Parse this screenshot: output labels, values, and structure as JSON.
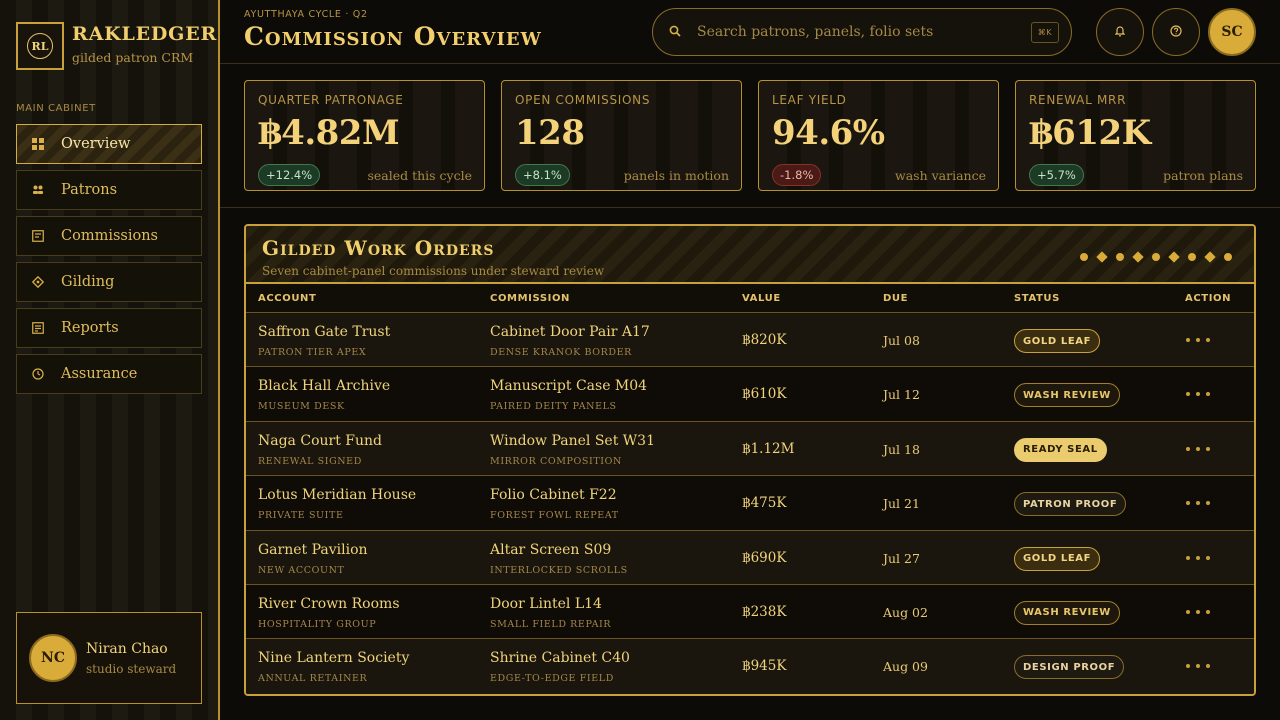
{
  "brand": {
    "initials": "RL",
    "name": "RAKLEDGER",
    "tagline": "gilded patron CRM"
  },
  "sidebar": {
    "section_label": "MAIN CABINET",
    "items": [
      {
        "label": "Overview",
        "icon": "grid-icon",
        "active": true
      },
      {
        "label": "Patrons",
        "icon": "people-icon",
        "active": false
      },
      {
        "label": "Commissions",
        "icon": "ledger-icon",
        "active": false
      },
      {
        "label": "Gilding",
        "icon": "diamond-icon",
        "active": false
      },
      {
        "label": "Reports",
        "icon": "report-icon",
        "active": false
      },
      {
        "label": "Assurance",
        "icon": "clock-icon",
        "active": false
      }
    ],
    "user": {
      "initials": "NC",
      "name": "Niran Chao",
      "role": "studio steward"
    }
  },
  "header": {
    "eyebrow": "AYUTTHAYA CYCLE · Q2",
    "title": "Commission Overview",
    "search_placeholder": "Search patrons, panels, folio sets",
    "search_shortcut": "⌘K",
    "user_initials": "SC"
  },
  "kpis": [
    {
      "label": "QUARTER PATRONAGE",
      "value": "฿4.82M",
      "delta": "+12.4%",
      "trend": "up",
      "note": "sealed this cycle"
    },
    {
      "label": "OPEN COMMISSIONS",
      "value": "128",
      "delta": "+8.1%",
      "trend": "up",
      "note": "panels in motion"
    },
    {
      "label": "LEAF YIELD",
      "value": "94.6%",
      "delta": "-1.8%",
      "trend": "down",
      "note": "wash variance"
    },
    {
      "label": "RENEWAL MRR",
      "value": "฿612K",
      "delta": "+5.7%",
      "trend": "up",
      "note": "patron plans"
    }
  ],
  "table": {
    "title": "Gilded Work Orders",
    "subtitle": "Seven cabinet-panel commissions under steward review",
    "columns": [
      "ACCOUNT",
      "COMMISSION",
      "VALUE",
      "DUE",
      "STATUS",
      "ACTION"
    ],
    "rows": [
      {
        "account": "Saffron Gate Trust",
        "account_sub": "PATRON TIER APEX",
        "commission": "Cabinet Door Pair A17",
        "commission_sub": "DENSE KRANOK BORDER",
        "value": "฿820K",
        "due": "Jul 08",
        "status": "GOLD LEAF",
        "status_kind": "gold"
      },
      {
        "account": "Black Hall Archive",
        "account_sub": "MUSEUM DESK",
        "commission": "Manuscript Case M04",
        "commission_sub": "PAIRED DEITY PANELS",
        "value": "฿610K",
        "due": "Jul 12",
        "status": "WASH REVIEW",
        "status_kind": "wash"
      },
      {
        "account": "Naga Court Fund",
        "account_sub": "RENEWAL SIGNED",
        "commission": "Window Panel Set W31",
        "commission_sub": "MIRROR COMPOSITION",
        "value": "฿1.12M",
        "due": "Jul 18",
        "status": "READY SEAL",
        "status_kind": "ready"
      },
      {
        "account": "Lotus Meridian House",
        "account_sub": "PRIVATE SUITE",
        "commission": "Folio Cabinet F22",
        "commission_sub": "FOREST FOWL REPEAT",
        "value": "฿475K",
        "due": "Jul 21",
        "status": "PATRON PROOF",
        "status_kind": "patron"
      },
      {
        "account": "Garnet Pavilion",
        "account_sub": "NEW ACCOUNT",
        "commission": "Altar Screen S09",
        "commission_sub": "INTERLOCKED SCROLLS",
        "value": "฿690K",
        "due": "Jul 27",
        "status": "GOLD LEAF",
        "status_kind": "gold"
      },
      {
        "account": "River Crown Rooms",
        "account_sub": "HOSPITALITY GROUP",
        "commission": "Door Lintel L14",
        "commission_sub": "SMALL FIELD REPAIR",
        "value": "฿238K",
        "due": "Aug 02",
        "status": "WASH REVIEW",
        "status_kind": "wash"
      },
      {
        "account": "Nine Lantern Society",
        "account_sub": "ANNUAL RETAINER",
        "commission": "Shrine Cabinet C40",
        "commission_sub": "EDGE-TO-EDGE FIELD",
        "value": "฿945K",
        "due": "Aug 09",
        "status": "DESIGN PROOF",
        "status_kind": "design"
      }
    ]
  },
  "colors": {
    "accent": "#d9ac3a",
    "background": "#0d0b07",
    "text": "#f0d37b",
    "positive": "#1d3a26",
    "negative": "#4a1a16"
  }
}
